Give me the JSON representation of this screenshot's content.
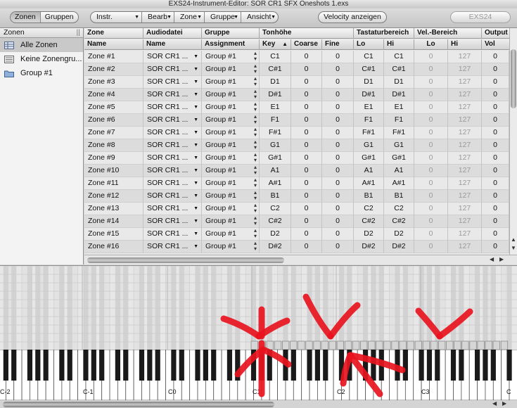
{
  "window": {
    "title": "EXS24-Instrument-Editor: SOR CR1 SFX Oneshots 1.exs"
  },
  "toolbar": {
    "view_tabs": [
      "Zonen",
      "Gruppen"
    ],
    "menus": [
      "Instr.",
      "Bearb",
      "Zone",
      "Gruppe",
      "Ansicht"
    ],
    "velocity_button": "Velocity anzeigen",
    "exs_button": "EXS24"
  },
  "sidebar": {
    "header": "Zonen",
    "items": [
      {
        "label": "Alle Zonen",
        "selected": true,
        "icon": "grid-icon"
      },
      {
        "label": "Keine Zonengru...",
        "selected": false,
        "icon": "list-icon"
      },
      {
        "label": "Group #1",
        "selected": false,
        "icon": "folder-icon"
      }
    ]
  },
  "table": {
    "group_headers": [
      "Zone",
      "Audiodatei",
      "Gruppe",
      "Tonhöhe",
      "Tastaturbereich",
      "Vel.-Bereich",
      "Output"
    ],
    "columns": [
      "Name",
      "Name",
      "Assignment",
      "Key",
      "Coarse",
      "Fine",
      "Lo",
      "Hi",
      "Lo",
      "Hi",
      "Vol"
    ],
    "rows": [
      [
        "Zone #1",
        "SOR CR1 ...",
        "Group #1",
        "C1",
        "0",
        "0",
        "C1",
        "C1",
        "0",
        "127",
        "0"
      ],
      [
        "Zone #2",
        "SOR CR1 ...",
        "Group #1",
        "C#1",
        "0",
        "0",
        "C#1",
        "C#1",
        "0",
        "127",
        "0"
      ],
      [
        "Zone #3",
        "SOR CR1 ...",
        "Group #1",
        "D1",
        "0",
        "0",
        "D1",
        "D1",
        "0",
        "127",
        "0"
      ],
      [
        "Zone #4",
        "SOR CR1 ...",
        "Group #1",
        "D#1",
        "0",
        "0",
        "D#1",
        "D#1",
        "0",
        "127",
        "0"
      ],
      [
        "Zone #5",
        "SOR CR1 ...",
        "Group #1",
        "E1",
        "0",
        "0",
        "E1",
        "E1",
        "0",
        "127",
        "0"
      ],
      [
        "Zone #6",
        "SOR CR1 ...",
        "Group #1",
        "F1",
        "0",
        "0",
        "F1",
        "F1",
        "0",
        "127",
        "0"
      ],
      [
        "Zone #7",
        "SOR CR1 ...",
        "Group #1",
        "F#1",
        "0",
        "0",
        "F#1",
        "F#1",
        "0",
        "127",
        "0"
      ],
      [
        "Zone #8",
        "SOR CR1 ...",
        "Group #1",
        "G1",
        "0",
        "0",
        "G1",
        "G1",
        "0",
        "127",
        "0"
      ],
      [
        "Zone #9",
        "SOR CR1 ...",
        "Group #1",
        "G#1",
        "0",
        "0",
        "G#1",
        "G#1",
        "0",
        "127",
        "0"
      ],
      [
        "Zone #10",
        "SOR CR1 ...",
        "Group #1",
        "A1",
        "0",
        "0",
        "A1",
        "A1",
        "0",
        "127",
        "0"
      ],
      [
        "Zone #11",
        "SOR CR1 ...",
        "Group #1",
        "A#1",
        "0",
        "0",
        "A#1",
        "A#1",
        "0",
        "127",
        "0"
      ],
      [
        "Zone #12",
        "SOR CR1 ...",
        "Group #1",
        "B1",
        "0",
        "0",
        "B1",
        "B1",
        "0",
        "127",
        "0"
      ],
      [
        "Zone #13",
        "SOR CR1 ...",
        "Group #1",
        "C2",
        "0",
        "0",
        "C2",
        "C2",
        "0",
        "127",
        "0"
      ],
      [
        "Zone #14",
        "SOR CR1 ...",
        "Group #1",
        "C#2",
        "0",
        "0",
        "C#2",
        "C#2",
        "0",
        "127",
        "0"
      ],
      [
        "Zone #15",
        "SOR CR1 ...",
        "Group #1",
        "D2",
        "0",
        "0",
        "D2",
        "D2",
        "0",
        "127",
        "0"
      ],
      [
        "Zone #16",
        "SOR CR1 ...",
        "Group #1",
        "D#2",
        "0",
        "0",
        "D#2",
        "D#2",
        "0",
        "127",
        "0"
      ]
    ]
  },
  "keyboard": {
    "octave_labels": [
      "C-2",
      "C-1",
      "C0",
      "C1",
      "C2",
      "C3"
    ],
    "zone_count": 33
  },
  "colors": {
    "annotation": "#e8141e",
    "selection": "#c9c9c9"
  }
}
